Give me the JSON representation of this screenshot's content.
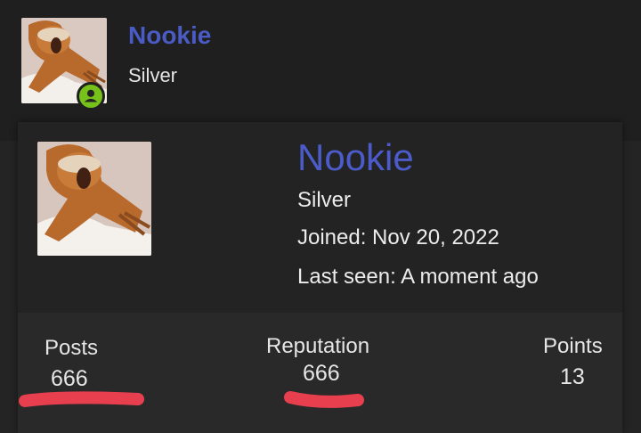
{
  "header": {
    "username": "Nookie",
    "rank": "Silver",
    "online_icon": "user-online-icon",
    "avatar": "sloth-avatar"
  },
  "profile_card": {
    "username": "Nookie",
    "rank": "Silver",
    "joined": "Joined: Nov 20, 2022",
    "last_seen": "Last seen: A moment ago",
    "avatar": "sloth-avatar"
  },
  "stats": {
    "posts_label": "Posts",
    "posts_value": "666",
    "reputation_label": "Reputation",
    "reputation_value": "666",
    "points_label": "Points",
    "points_value": "13"
  },
  "colors": {
    "username": "#4a5bc4",
    "online": "#76c21b",
    "redaction": "#e83f4f",
    "background": "#242424"
  }
}
